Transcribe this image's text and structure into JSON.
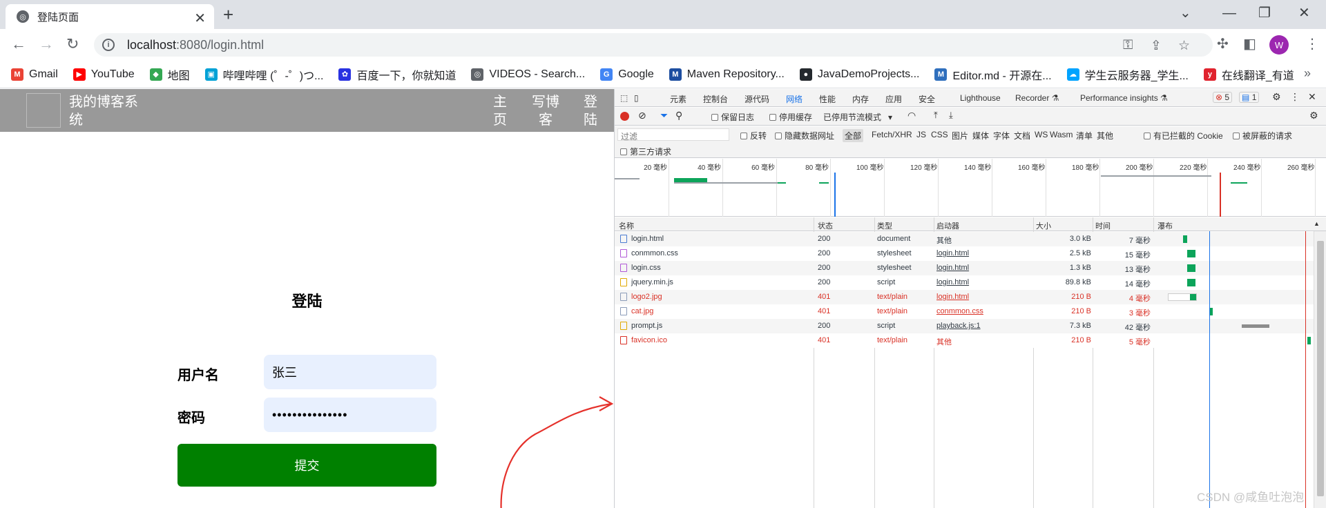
{
  "browser": {
    "tab_title": "登陆页面",
    "tab_close": "✕",
    "new_tab": "+",
    "url_host": "localhost",
    "url_rest": ":8080/login.html",
    "avatar_letter": "W",
    "win_min": "—",
    "win_restore": "❐",
    "win_close": "✕",
    "win_dropdown": "⌄"
  },
  "bookmarks": [
    {
      "label": "Gmail",
      "icon": "gmail-icon",
      "color": "#ea4335",
      "glyph": "M"
    },
    {
      "label": "YouTube",
      "icon": "youtube-icon",
      "color": "#ff0000",
      "glyph": "▶"
    },
    {
      "label": "地图",
      "icon": "maps-icon",
      "color": "#34a853",
      "glyph": "◆"
    },
    {
      "label": "哔哩哔哩 (゜-゜)つ...",
      "icon": "bilibili-icon",
      "color": "#00a1d6",
      "glyph": "▣"
    },
    {
      "label": "百度一下，你就知道",
      "icon": "baidu-icon",
      "color": "#2932e1",
      "glyph": "✿"
    },
    {
      "label": "VIDEOS - Search...",
      "icon": "globe-icon",
      "color": "#5f6368",
      "glyph": "◎"
    },
    {
      "label": "Google",
      "icon": "google-icon",
      "color": "#4285f4",
      "glyph": "G"
    },
    {
      "label": "Maven Repository...",
      "icon": "maven-icon",
      "color": "#1d4ea0",
      "glyph": "M"
    },
    {
      "label": "JavaDemoProjects...",
      "icon": "github-icon",
      "color": "#24292e",
      "glyph": "●"
    },
    {
      "label": "Editor.md - 开源在...",
      "icon": "editormd-icon",
      "color": "#2f6fbd",
      "glyph": "M"
    },
    {
      "label": "学生云服务器_学生...",
      "icon": "cloud-icon",
      "color": "#00a3ff",
      "glyph": "☁"
    },
    {
      "label": "在线翻译_有道",
      "icon": "youdao-icon",
      "color": "#e0232e",
      "glyph": "y"
    }
  ],
  "bookmarks_more": "»",
  "site": {
    "title": "我的博客系统",
    "nav_links": [
      "主页",
      "写博客",
      "登陆"
    ],
    "login_title": "登陆",
    "username_label": "用户名",
    "username_value": "张三",
    "password_label": "密码",
    "password_value": "•••••••••••••••",
    "submit_label": "提交"
  },
  "devtools": {
    "tabs": [
      "元素",
      "控制台",
      "源代码",
      "网络",
      "性能",
      "内存",
      "应用",
      "安全",
      "Lighthouse",
      "Recorder ⚗",
      "Performance insights ⚗"
    ],
    "active_tab": "网络",
    "error_count": "5",
    "message_count": "1",
    "preserve_log": "保留日志",
    "disable_cache": "停用缓存",
    "throttle": "已停用节流模式",
    "filter_placeholder": "过滤",
    "invert": "反转",
    "hide_data_urls": "隐藏数据网址",
    "filter_types": [
      "全部",
      "Fetch/XHR",
      "JS",
      "CSS",
      "图片",
      "媒体",
      "字体",
      "文档",
      "WS",
      "Wasm",
      "清单",
      "其他"
    ],
    "blocked_cookies": "有已拦截的 Cookie",
    "blocked_requests": "被屏蔽的请求",
    "third_party": "第三方请求",
    "timeline_ticks": [
      "20 毫秒",
      "40 毫秒",
      "60 毫秒",
      "80 毫秒",
      "100 毫秒",
      "120 毫秒",
      "140 毫秒",
      "160 毫秒",
      "180 毫秒",
      "200 毫秒",
      "220 毫秒",
      "240 毫秒",
      "260 毫秒"
    ],
    "columns": [
      "名称",
      "状态",
      "类型",
      "启动器",
      "大小",
      "时间",
      "瀑布"
    ],
    "requests": [
      {
        "name": "login.html",
        "status": "200",
        "type": "document",
        "initiator": "其他",
        "size": "3.0 kB",
        "time": "7 毫秒",
        "error": false,
        "link": false,
        "icon": "document-icon"
      },
      {
        "name": "conmmon.css",
        "status": "200",
        "type": "stylesheet",
        "initiator": "login.html",
        "size": "2.5 kB",
        "time": "15 毫秒",
        "error": false,
        "link": true,
        "icon": "stylesheet-icon"
      },
      {
        "name": "login.css",
        "status": "200",
        "type": "stylesheet",
        "initiator": "login.html",
        "size": "1.3 kB",
        "time": "13 毫秒",
        "error": false,
        "link": true,
        "icon": "stylesheet-icon"
      },
      {
        "name": "jquery.min.js",
        "status": "200",
        "type": "script",
        "initiator": "login.html",
        "size": "89.8 kB",
        "time": "14 毫秒",
        "error": false,
        "link": true,
        "icon": "script-icon"
      },
      {
        "name": "logo2.jpg",
        "status": "401",
        "type": "text/plain",
        "initiator": "login.html",
        "size": "210 B",
        "time": "4 毫秒",
        "error": true,
        "link": true,
        "icon": "image-icon"
      },
      {
        "name": "cat.jpg",
        "status": "401",
        "type": "text/plain",
        "initiator": "conmmon.css",
        "size": "210 B",
        "time": "3 毫秒",
        "error": true,
        "link": true,
        "icon": "image-icon"
      },
      {
        "name": "prompt.js",
        "status": "200",
        "type": "script",
        "initiator": "playback.js:1",
        "size": "7.3 kB",
        "time": "42 毫秒",
        "error": false,
        "link": true,
        "icon": "script-icon"
      },
      {
        "name": "favicon.ico",
        "status": "401",
        "type": "text/plain",
        "initiator": "其他",
        "size": "210 B",
        "time": "5 毫秒",
        "error": true,
        "link": false,
        "icon": "favicon-file-icon"
      }
    ]
  },
  "watermark": "CSDN @咸鱼吐泡泡",
  "colors": {
    "nav_bg": "#999999",
    "submit_bg": "#008000",
    "input_bg": "#e8f0fe",
    "error_red": "#d93025",
    "accent_blue": "#1a73e8",
    "waterfall_green": "#0ca45a"
  }
}
